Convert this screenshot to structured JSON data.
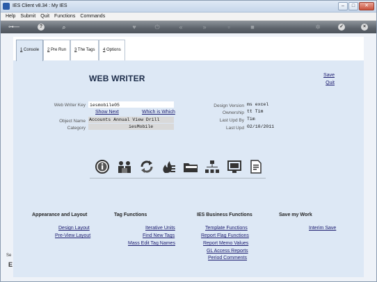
{
  "window": {
    "title": "IES Client v8.34 : My IES"
  },
  "window_buttons": {
    "minimize": "–",
    "maximize": "□",
    "close": "✕"
  },
  "menu": [
    "Help",
    "Submit",
    "Quit",
    "Functions",
    "Commands"
  ],
  "toolbar": {
    "icons": [
      "key-icon",
      "help-icon",
      "search-icon",
      "heart-icon",
      "power-icon",
      "rewind-icon",
      "fast-forward-icon",
      "mark-icon",
      "stop-icon",
      "settings-icon",
      "check-icon",
      "close-circle-icon"
    ]
  },
  "tabs": [
    {
      "num": "1",
      "label": "Console"
    },
    {
      "num": "2",
      "label": "Pre Run"
    },
    {
      "num": "3",
      "label": "The Tags"
    },
    {
      "num": "4",
      "label": "Options"
    }
  ],
  "page": {
    "title": "WEB WRITER",
    "save": "Save",
    "quit": "Quit"
  },
  "fields": {
    "web_writer_key": {
      "label": "Web Writer Key",
      "value": "iesmobile05"
    },
    "show_next": "Show Next",
    "which_is_which": "Which is Which",
    "object_name": {
      "label": "Object Name",
      "value": "Accounts Annual View Drill"
    },
    "category": {
      "label": "Category",
      "value": "iesMobile"
    },
    "design_version": {
      "label": "Design Version",
      "value": "ms excel"
    },
    "ownership": {
      "label": "Ownership",
      "value": "tt Tim"
    },
    "last_upd_by": {
      "label": "Last Upd By",
      "value": "Tim"
    },
    "last_upd": {
      "label": "Last Upd",
      "value": "02/10/2011"
    }
  },
  "function_icons": [
    "info-icon",
    "users-icon",
    "refresh-icon",
    "fire-list-icon",
    "folder-icon",
    "sitemap-icon",
    "monitor-icon",
    "document-icon"
  ],
  "sections": {
    "appearance": {
      "title": "Appearance and Layout",
      "links": [
        "Design Layout",
        "Pre-View Layout"
      ]
    },
    "tag_functions": {
      "title": "Tag Functions",
      "links": [
        "Iterative Units",
        "Find New Tags",
        "Mass Edit Tag Names"
      ]
    },
    "business": {
      "title": "IES Business Functions",
      "links": [
        "Template Functions",
        "Report Flag Functions",
        "Report Memo Values",
        "GL Access Reports",
        "Period Comments"
      ]
    },
    "save_work": {
      "title": "Save my Work",
      "links": [
        "Interim Save"
      ]
    }
  },
  "side_fragment": {
    "text": "Se",
    "letter": "E"
  },
  "colors": {
    "link": "#1a1a6e",
    "panel": "#dde8f5",
    "toolbar": "#5d646c"
  }
}
